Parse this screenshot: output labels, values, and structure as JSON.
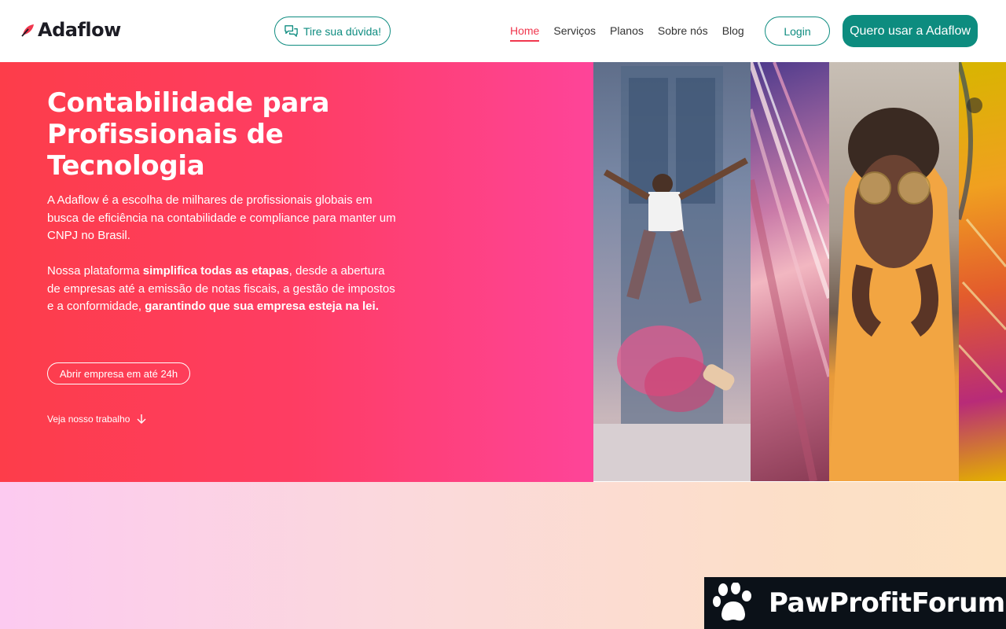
{
  "header": {
    "logo_text": "Adaflow",
    "question_button": "Tire sua dúvida!",
    "nav": [
      {
        "label": "Home",
        "active": true
      },
      {
        "label": "Serviços",
        "active": false
      },
      {
        "label": "Planos",
        "active": false
      },
      {
        "label": "Sobre nós",
        "active": false
      },
      {
        "label": "Blog",
        "active": false
      }
    ],
    "login_button": "Login",
    "cta_button": "Quero usar a Adaflow"
  },
  "hero": {
    "title": "Contabilidade para Profissionais de Tecnologia",
    "paragraph1": "A Adaflow é a escolha de milhares de profissionais globais em busca de eficiência na contabilidade e compliance para manter um CNPJ no Brasil.",
    "paragraph2": {
      "part1": "Nossa plataforma ",
      "bold1": "simplifica todas as etapas",
      "part2": ", desde a abertura de empresas até a emissão de notas fiscais, a gestão de impostos e a conformidade, ",
      "bold2": "garantindo que sua empresa esteja na lei."
    },
    "open_company_button": "Abrir empresa em até 24h",
    "see_work_link": "Veja nosso trabalho"
  },
  "watermark": {
    "text": "PawProfitForum"
  },
  "colors": {
    "brand_teal": "#0d8c7f",
    "active_nav": "#f0374e",
    "hero_gradient_start": "#fd3d4a",
    "hero_gradient_end": "#fe4499"
  }
}
